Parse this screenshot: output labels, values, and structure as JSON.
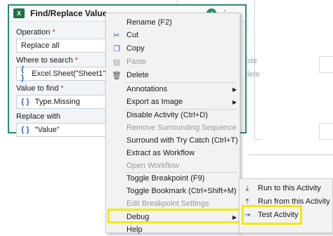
{
  "activity": {
    "title": "Find/Replace Value",
    "excel_badge": "X",
    "operation_label": "Operation",
    "operation_value": "Replace all",
    "where_label": "Where to search",
    "where_value": "Excel.Sheet(\"Sheet1\")",
    "value_label": "Value to find",
    "value_value": "Type.Missing",
    "replace_label": "Replace with",
    "replace_value": "\"Value\"",
    "required_mark": "*",
    "expression_glyph": "{ }"
  },
  "context_menu": {
    "items": [
      {
        "label": "Rename (F2)",
        "icon": "",
        "disabled": false
      },
      {
        "label": "Cut",
        "icon": "scissors-icon",
        "disabled": false
      },
      {
        "label": "Copy",
        "icon": "copy-icon",
        "disabled": false
      },
      {
        "label": "Paste",
        "icon": "paste-icon",
        "disabled": true
      },
      {
        "label": "Delete",
        "icon": "trash-icon",
        "disabled": false
      },
      {
        "label": "Annotations",
        "icon": "",
        "disabled": false,
        "submenu": true
      },
      {
        "label": "Export as Image",
        "icon": "",
        "disabled": false,
        "submenu": true
      },
      {
        "label": "Disable Activity (Ctrl+D)",
        "icon": "",
        "disabled": false
      },
      {
        "label": "Remove Surrounding Sequence",
        "icon": "",
        "disabled": true
      },
      {
        "label": "Surround with Try Catch (Ctrl+T)",
        "icon": "",
        "disabled": false
      },
      {
        "label": "Extract as Workflow",
        "icon": "",
        "disabled": false
      },
      {
        "label": "Open Workflow",
        "icon": "",
        "disabled": true
      },
      {
        "label": "Toggle Breakpoint (F9)",
        "icon": "",
        "disabled": false
      },
      {
        "label": "Toggle Bookmark (Ctrl+Shift+M)",
        "icon": "",
        "disabled": false
      },
      {
        "label": "Edit Breakpoint Settings",
        "icon": "",
        "disabled": true
      },
      {
        "label": "Debug",
        "icon": "",
        "disabled": false,
        "submenu": true
      },
      {
        "label": "Help",
        "icon": "",
        "disabled": false
      }
    ],
    "submenu_arrow": "▶"
  },
  "debug_submenu": {
    "items": [
      {
        "label": "Run to this Activity",
        "icon": "run-to-icon"
      },
      {
        "label": "Run from this Activity",
        "icon": "run-from-icon"
      },
      {
        "label": "Test Activity",
        "icon": "test-activity-icon"
      }
    ]
  },
  "background_ghost": {
    "paste": "Paste",
    "delete": "Delete"
  },
  "colors": {
    "activity_border": "#2b8a6d",
    "highlight": "#f2ea00",
    "expression_blue": "#2a64c9"
  }
}
